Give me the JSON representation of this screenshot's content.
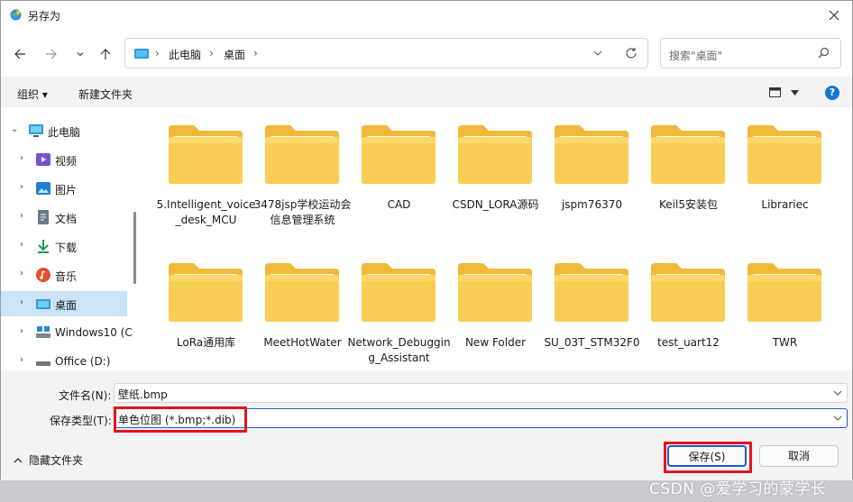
{
  "window": {
    "title": "另存为"
  },
  "address": {
    "crumbs": [
      "此电脑",
      "桌面"
    ],
    "sep": "›"
  },
  "search": {
    "placeholder": "搜索\"桌面\""
  },
  "toolbar": {
    "organize": "组织 ▾",
    "new_folder": "新建文件夹",
    "help": "?"
  },
  "sidebar": {
    "items": [
      {
        "label": "此电脑",
        "icon": "pc-icon",
        "expanded": true
      },
      {
        "label": "视频",
        "icon": "video-icon"
      },
      {
        "label": "图片",
        "icon": "pictures-icon"
      },
      {
        "label": "文档",
        "icon": "documents-icon"
      },
      {
        "label": "下载",
        "icon": "download-icon"
      },
      {
        "label": "音乐",
        "icon": "music-icon"
      },
      {
        "label": "桌面",
        "icon": "desktop-icon",
        "selected": true
      },
      {
        "label": "Windows10 (C",
        "icon": "drive-icon"
      },
      {
        "label": "Office (D:)",
        "icon": "drive-icon"
      }
    ]
  },
  "folders": [
    "5.Intelligent_voice_desk_MCU",
    "3478jsp学校运动会信息管理系统",
    "CAD",
    "CSDN_LORA源码",
    "jspm76370",
    "Keil5安装包",
    "Librariec",
    "LoRa通用库",
    "MeetHotWater",
    "Network_Debugging_Assistant",
    "New Folder",
    "SU_03T_STM32F0",
    "test_uart12",
    "TWR"
  ],
  "form": {
    "filename_label": "文件名(N):",
    "filename_value": "壁纸.bmp",
    "filetype_label": "保存类型(T):",
    "filetype_value": "单色位图 (*.bmp;*.dib)"
  },
  "footer": {
    "hide_folders": "隐藏文件夹",
    "save": "保存(S)",
    "cancel": "取消"
  },
  "watermark": "CSDN @爱学习的蒙学长",
  "colors": {
    "accent": "#1a5bd6",
    "highlight_box": "#e3141f",
    "folder": "#f8cd54",
    "selected": "#cce4f7"
  }
}
